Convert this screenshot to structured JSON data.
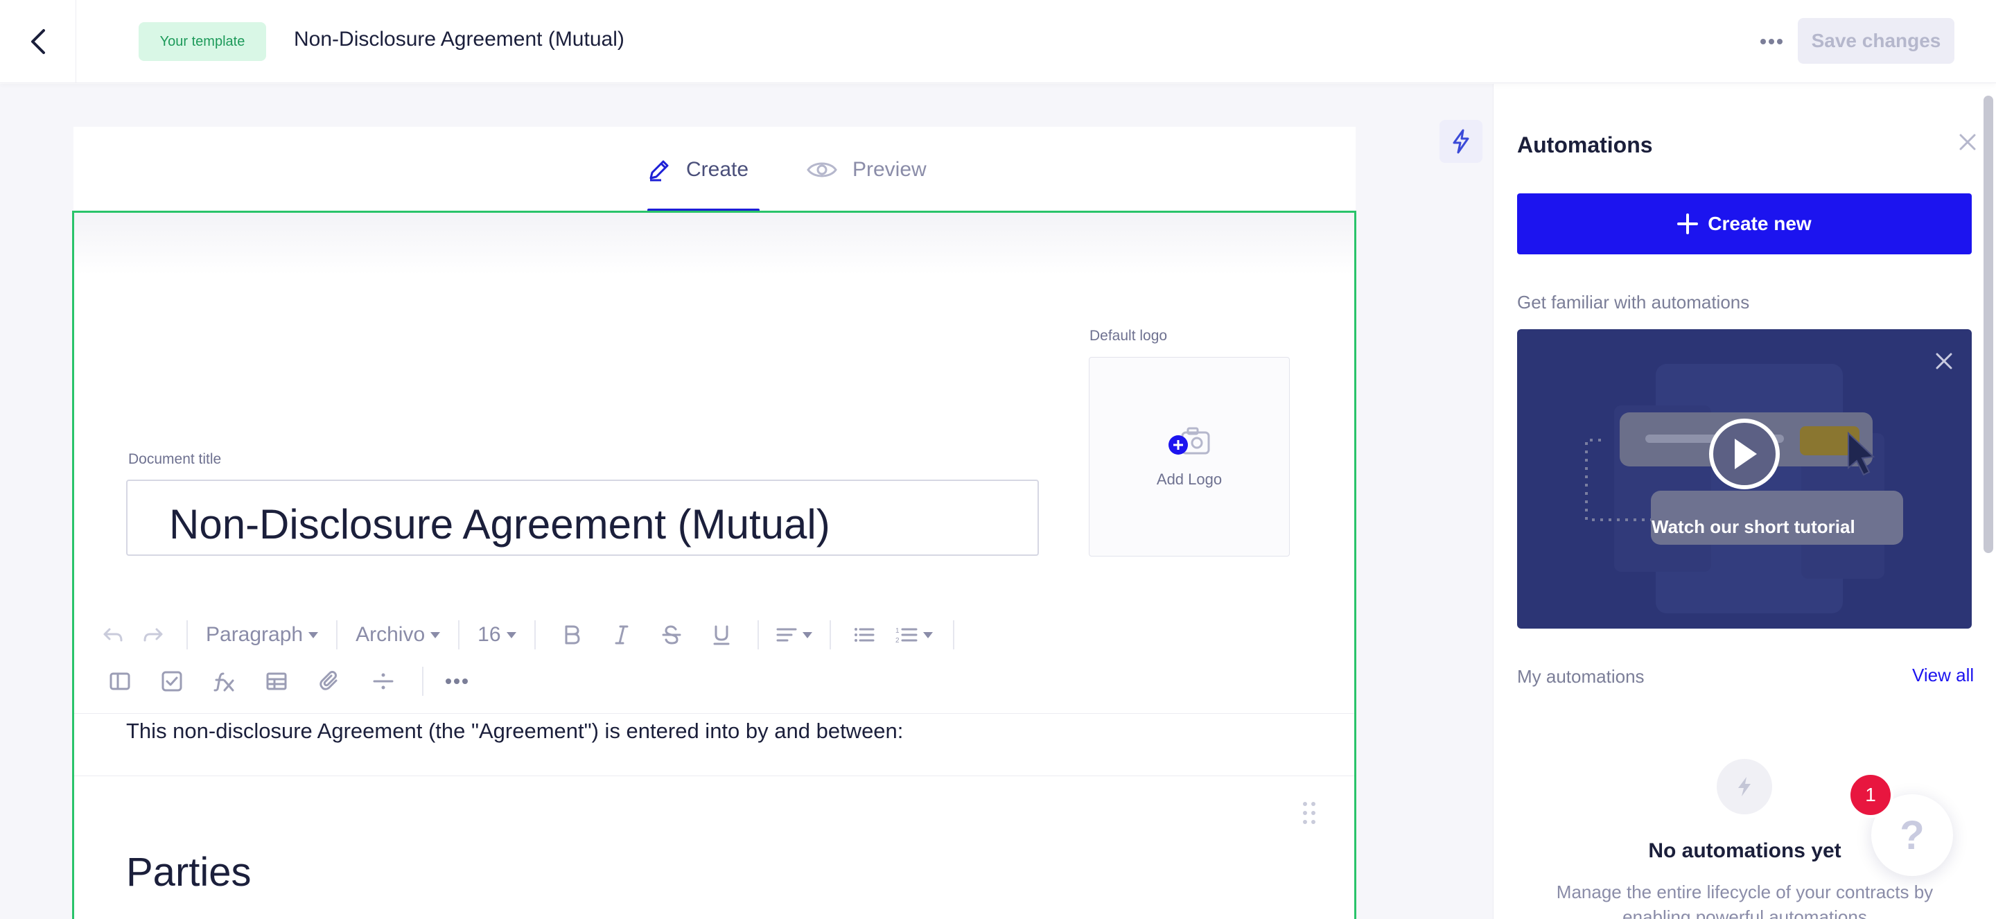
{
  "header": {
    "template_badge": "Your template",
    "document_name": "Non-Disclosure Agreement (Mutual)",
    "save_label": "Save changes"
  },
  "editor_tabs": [
    {
      "label": "Create",
      "active": true
    },
    {
      "label": "Preview",
      "active": false
    }
  ],
  "document": {
    "logo_label": "Default logo",
    "add_logo": "Add Logo",
    "title_label": "Document title",
    "title_value": "Non-Disclosure Agreement (Mutual)",
    "intro_text": "This non-disclosure Agreement (the \"Agreement\") is entered into by and between:",
    "section_heading": "Parties"
  },
  "toolbar": {
    "block_style": "Paragraph",
    "font_family": "Archivo",
    "font_size": "16",
    "icons": [
      "undo-icon",
      "redo-icon",
      "bold-icon",
      "italic-icon",
      "strikethrough-icon",
      "underline-icon",
      "align-icon",
      "bullet-list-icon",
      "numbered-list-icon",
      "columns-icon",
      "checkbox-icon",
      "formula-icon",
      "table-icon",
      "attachment-icon",
      "divider-icon",
      "more-icon"
    ]
  },
  "panel": {
    "title": "Automations",
    "create_label": "Create new",
    "familiar_label": "Get familiar with automations",
    "video_caption": "Watch our short tutorial",
    "my_automations": "My automations",
    "view_all": "View all",
    "empty_title": "No automations yet",
    "empty_desc": "Manage the entire lifecycle of your contracts by enabling powerful automations"
  },
  "help": {
    "label": "?",
    "badge_count": "1"
  },
  "colors": {
    "accent": "#1c14ef",
    "active_border": "#2ac36a",
    "badge_bg": "#d9f7e6",
    "badge_text": "#1d9a5a",
    "notification": "#e8163f",
    "video_bg": "#2c3575"
  }
}
